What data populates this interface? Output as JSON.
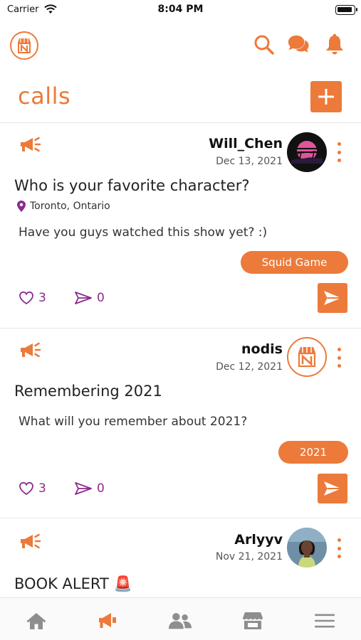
{
  "status_bar": {
    "carrier": "Carrier",
    "time": "8:04 PM"
  },
  "header": {
    "title": "calls"
  },
  "colors": {
    "accent": "#ec7a3a",
    "reaction": "#8a2b8f",
    "tab_inactive": "#8e8e8e"
  },
  "icons": {
    "header": [
      "logo-icon",
      "search-icon",
      "chat-icon",
      "bell-icon"
    ],
    "post_type": "megaphone-icon",
    "tabs": [
      "home-icon",
      "megaphone-icon",
      "people-icon",
      "store-icon",
      "menu-icon"
    ]
  },
  "posts": [
    {
      "author": "Will_Chen",
      "date": "Dec 13, 2021",
      "title": "Who is your favorite character?",
      "location": "Toronto, Ontario",
      "body": "Have you guys watched this show yet? :)",
      "tag": "Squid Game",
      "likes": "3",
      "shares": "0"
    },
    {
      "author": "nodis",
      "date": "Dec 12, 2021",
      "title": "Remembering 2021",
      "body": "What will you remember about 2021?",
      "tag": "2021",
      "likes": "3",
      "shares": "0"
    },
    {
      "author": "Arlyyv",
      "date": "Nov 21, 2021",
      "title": "BOOK ALERT 🚨"
    }
  ],
  "tab_bar": {
    "active_index": 1
  }
}
